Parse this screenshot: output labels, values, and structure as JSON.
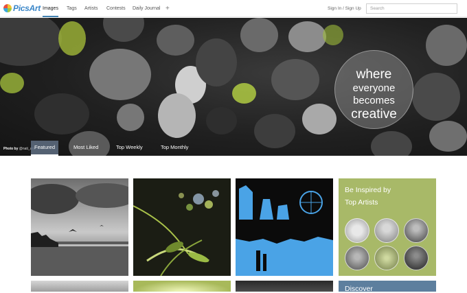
{
  "logo": {
    "text": "PicsArt"
  },
  "nav": {
    "items": [
      {
        "label": "Images",
        "active": true
      },
      {
        "label": "Tags"
      },
      {
        "label": "Artists"
      },
      {
        "label": "Contests"
      },
      {
        "label": "Daily Journal"
      }
    ],
    "plus_label": "+",
    "signin_label": "Sign In / Sign Up",
    "search_placeholder": "Search"
  },
  "hero": {
    "slogan": [
      "where",
      "everyone",
      "becomes",
      "creative"
    ],
    "credit_prefix": "Photo by",
    "credit_user": "@nati_ara",
    "tabs": [
      {
        "label": "Featured",
        "active": true
      },
      {
        "label": "Most Liked"
      },
      {
        "label": "Top Weekly"
      },
      {
        "label": "Top Monthly"
      }
    ]
  },
  "sidebar_card": {
    "title_line1": "Be Inspired by",
    "title_line2": "Top Artists",
    "avatars_count": 6
  },
  "discover_card": {
    "title": "Discover"
  },
  "colors": {
    "nav_active": "#3f7fae",
    "artists_bg": "#a8b968",
    "discover_bg": "#5d7f9e",
    "neon_green": "#b8e03a",
    "pop_blue": "#4aa3e6"
  }
}
